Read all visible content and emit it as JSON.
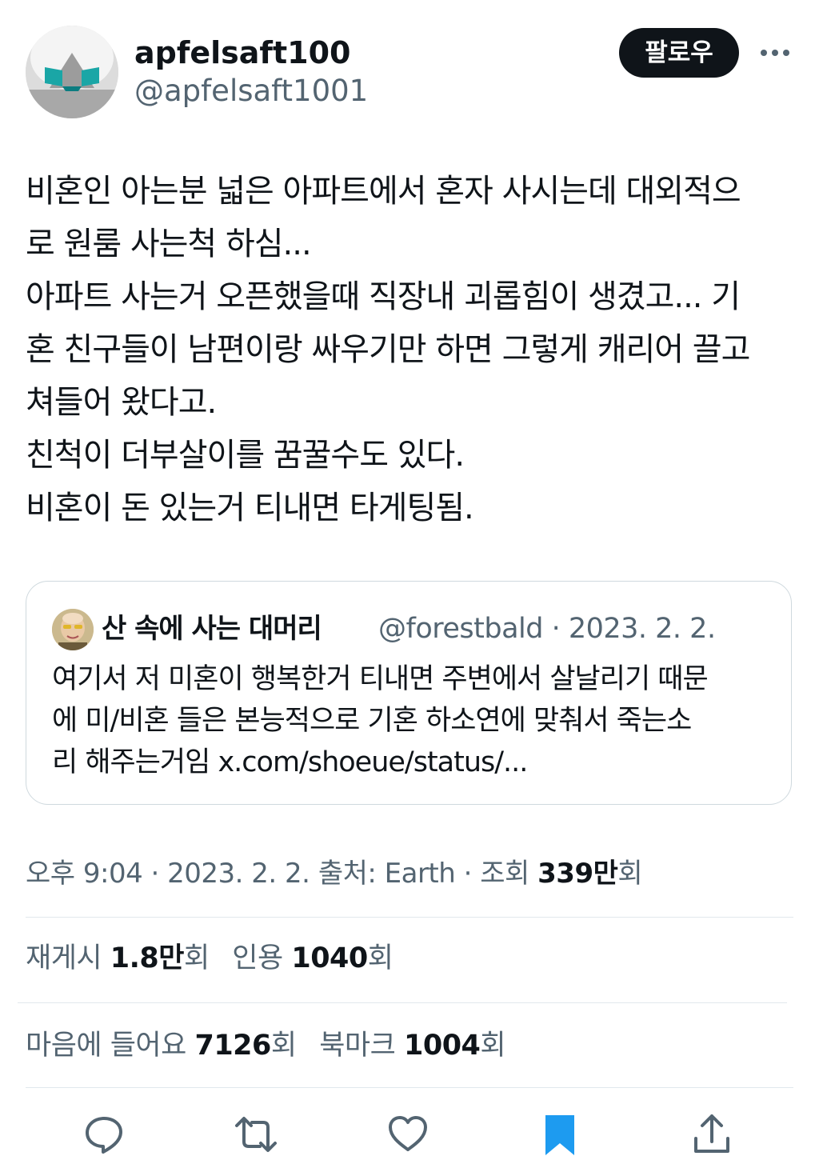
{
  "author": {
    "display_name": "apfelsaft100",
    "handle": "@apfelsaft1001"
  },
  "follow_label": "팔로우",
  "tweet": {
    "lines": [
      "비혼인 아는분 넓은 아파트에서 혼자 사시는데 대외적으",
      "로 원룸 사는척 하심...",
      "아파트 사는거 오픈했을때 직장내 괴롭힘이 생겼고... 기",
      "혼 친구들이 남편이랑 싸우기만 하면 그렇게 캐리어 끌고",
      "쳐들어 왔다고.",
      "친척이 더부살이를 꿈꿀수도 있다.",
      "비혼이 돈 있는거 티내면 타게팅됨."
    ]
  },
  "quote": {
    "display_name": "산 속에 사는 대머리",
    "meta": "@forestbald · 2023. 2. 2.",
    "lines": [
      "여기서 저 미혼이 행복한거 티내면 주변에서 살날리기 때문",
      "에 미/비혼 들은 본능적으로 기혼 하소연에 맞춰서 죽는소",
      "리 해주는거임 x.com/shoeue/status/..."
    ]
  },
  "meta": {
    "time": "오후 9:04",
    "date": "2023. 2. 2.",
    "source": "출처: Earth",
    "views_label": "조회",
    "views_value": "339만",
    "views_suffix": "회"
  },
  "stats": {
    "retweets_label": "재게시",
    "retweets_value": "1.8만",
    "retweets_suffix": "회",
    "quotes_label": "인용",
    "quotes_value": "1040",
    "quotes_suffix": "회",
    "likes_label": "마음에 들어요",
    "likes_value": "7126",
    "likes_suffix": "회",
    "bookmarks_label": "북마크",
    "bookmarks_value": "1004",
    "bookmarks_suffix": "회"
  },
  "colors": {
    "accent": "#1d9bf0",
    "text": "#0f1419",
    "secondary": "#536471",
    "icon": "#536471"
  },
  "icons": {
    "more": "more-dots-icon",
    "reply": "reply-icon",
    "retweet": "retweet-icon",
    "like": "heart-icon",
    "bookmark": "bookmark-icon",
    "share": "share-icon"
  }
}
